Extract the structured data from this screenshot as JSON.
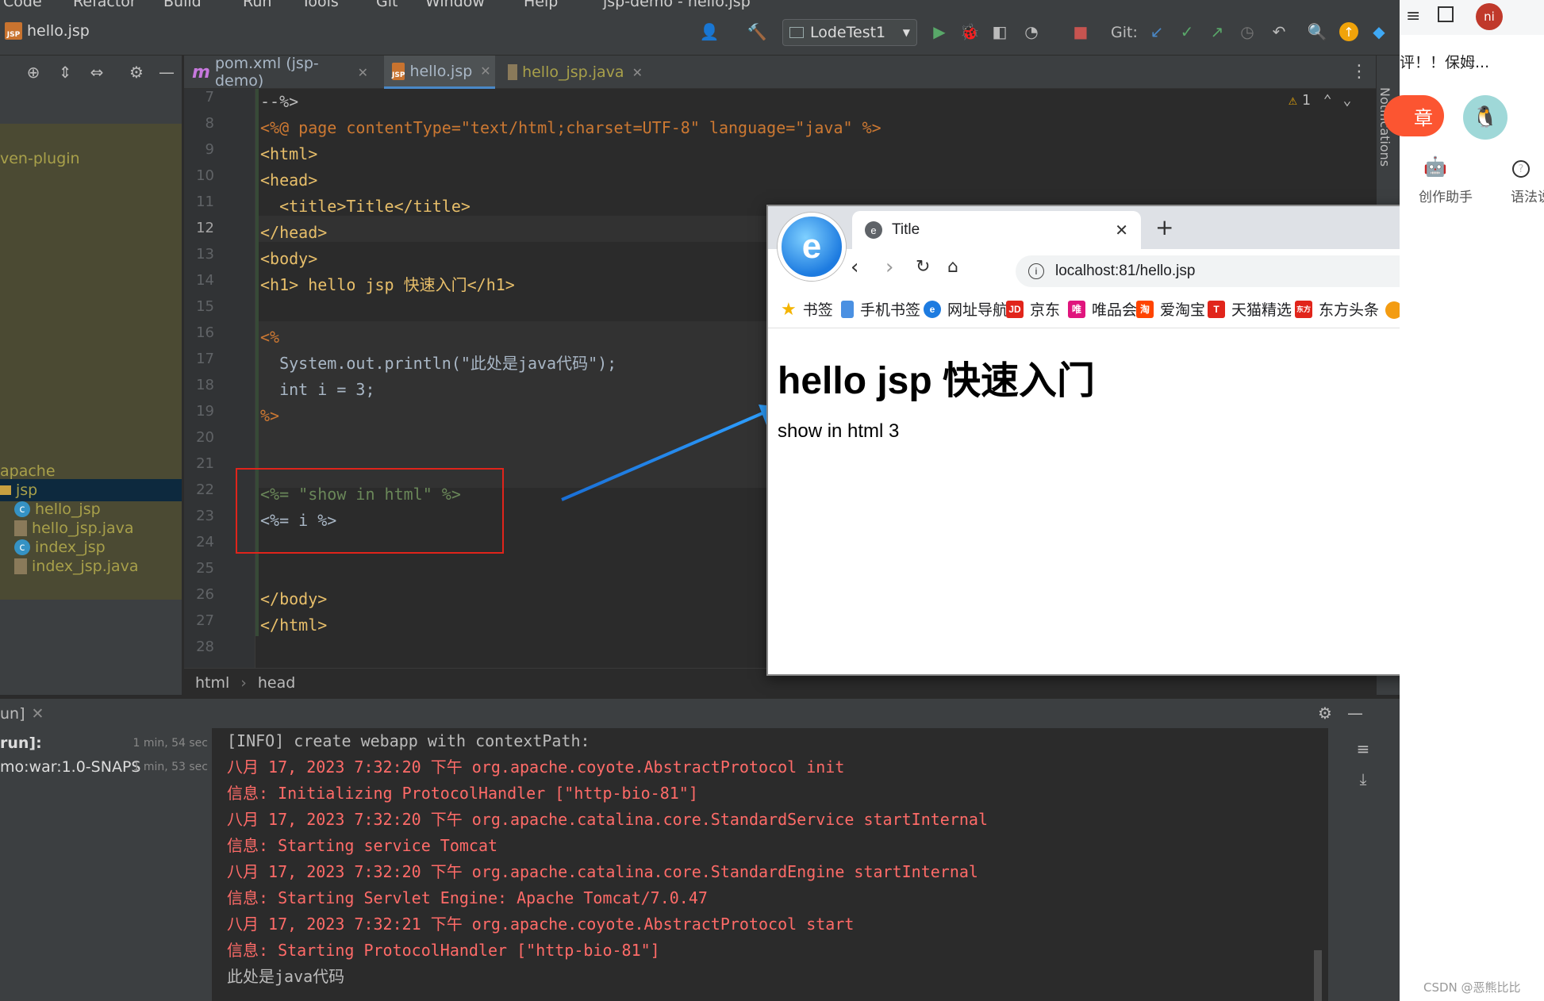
{
  "menu": [
    "Code",
    "Refactor",
    "Build",
    "Run",
    "Tools",
    "Git",
    "Window",
    "Help",
    "jsp-demo - hello.jsp"
  ],
  "toolbar": {
    "current_file": "hello.jsp",
    "run_config": "LodeTest1",
    "git_label": "Git:"
  },
  "editor_tabs": [
    {
      "label": "pom.xml (jsp-demo)",
      "icon": "maven-icon"
    },
    {
      "label": "hello.jsp",
      "icon": "jsp-file-icon",
      "active": true
    },
    {
      "label": "hello_jsp.java",
      "icon": "java-file-icon"
    }
  ],
  "project_tree": [
    {
      "label": "ven-plugin"
    },
    {
      "label": "apache"
    },
    {
      "label": "jsp",
      "selected": true
    },
    {
      "label": "hello_jsp"
    },
    {
      "label": "hello_jsp.java"
    },
    {
      "label": "index_jsp"
    },
    {
      "label": "index_jsp.java"
    }
  ],
  "editor": {
    "warnings": "1",
    "line_numbers": [
      "7",
      "8",
      "9",
      "10",
      "11",
      "12",
      "13",
      "14",
      "15",
      "16",
      "17",
      "18",
      "19",
      "20",
      "21",
      "22",
      "23",
      "24",
      "25",
      "26",
      "27",
      "28"
    ],
    "current_line": "12",
    "lines": [
      "--%>",
      "<%@ page contentType=\"text/html;charset=UTF-8\" language=\"java\" %>",
      "<html>",
      "<head>",
      "  <title>Title</title>",
      "</head>",
      "<body>",
      "<h1> hello jsp 快速入门</h1>",
      "",
      "<%",
      "  System.out.println(\"此处是java代码\");",
      "  int i = 3;",
      "%>",
      "",
      "",
      "<%= \"show in html\" %>",
      "<%= i %>",
      "",
      "",
      "</body>",
      "</html>",
      ""
    ],
    "breadcrumb": [
      "html",
      "head"
    ]
  },
  "notifications_label": "Notifications",
  "run_panel": {
    "tab_label": "un]",
    "tree": [
      {
        "label": "run]:",
        "time": "1 min, 54 sec"
      },
      {
        "label": "mo:war:1.0-SNAPS",
        "time": "1 min, 53 sec"
      }
    ],
    "console": [
      {
        "text": "[INFO] create webapp with contextPath:",
        "kind": "info"
      },
      {
        "text": "八月 17, 2023 7:32:20 下午 org.apache.coyote.AbstractProtocol init",
        "kind": "err"
      },
      {
        "text": "信息: Initializing ProtocolHandler [\"http-bio-81\"]",
        "kind": "err"
      },
      {
        "text": "八月 17, 2023 7:32:20 下午 org.apache.catalina.core.StandardService startInternal",
        "kind": "err"
      },
      {
        "text": "信息: Starting service Tomcat",
        "kind": "err"
      },
      {
        "text": "八月 17, 2023 7:32:20 下午 org.apache.catalina.core.StandardEngine startInternal",
        "kind": "err"
      },
      {
        "text": "信息: Starting Servlet Engine: Apache Tomcat/7.0.47",
        "kind": "err"
      },
      {
        "text": "八月 17, 2023 7:32:21 下午 org.apache.coyote.AbstractProtocol start",
        "kind": "err"
      },
      {
        "text": "信息: Starting ProtocolHandler [\"http-bio-81\"]",
        "kind": "err"
      },
      {
        "text": "此处是java代码",
        "kind": "info"
      }
    ]
  },
  "browser": {
    "tab_title": "Title",
    "url": "localhost:81/hello.jsp",
    "bookmarks": [
      {
        "label": "书签",
        "icon": "star-icon",
        "color": "#f4b400"
      },
      {
        "label": "手机书签",
        "icon": "phone-icon",
        "color": "#4a90e2"
      },
      {
        "label": "网址导航",
        "icon": "e-icon",
        "color": "#1d7be0"
      },
      {
        "label": "京东",
        "icon": "jd-icon",
        "color": "#e1251b"
      },
      {
        "label": "唯品会",
        "icon": "vip-icon",
        "color": "#e0157d"
      },
      {
        "label": "爱淘宝",
        "icon": "taobao-icon",
        "color": "#ff4400"
      },
      {
        "label": "天猫精选",
        "icon": "tmall-icon",
        "color": "#e1251b"
      },
      {
        "label": "东方头条",
        "icon": "dongfang-icon",
        "color": "#e1251b"
      }
    ],
    "page_heading": "hello jsp 快速入门",
    "page_text": "show in html 3"
  },
  "right_page": {
    "top_text": "评！！保姆...",
    "button": "章",
    "avatar_initials": "ni",
    "tool1": "创作助手",
    "tool2": "语法说"
  },
  "watermark": "CSDN @恶熊比比"
}
